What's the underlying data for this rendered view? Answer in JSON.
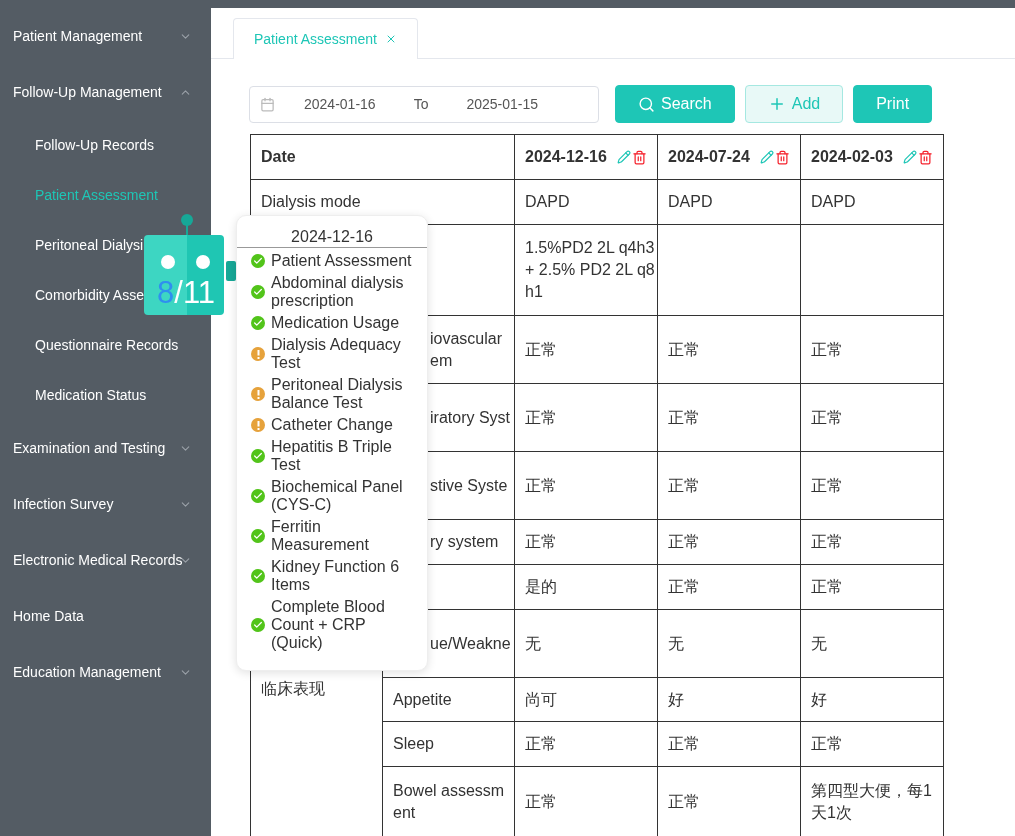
{
  "sidebar": {
    "items": [
      {
        "label": "Patient Management",
        "expandable": true,
        "expanded": false,
        "selected": false
      },
      {
        "label": "Follow-Up Management",
        "expandable": true,
        "expanded": true,
        "selected": false,
        "children": [
          {
            "label": "Follow-Up Records",
            "selected": false
          },
          {
            "label": "Patient Assessment",
            "selected": true
          },
          {
            "label": "Peritoneal Dialysi",
            "selected": false
          },
          {
            "label": "Comorbidity Asse",
            "selected": false
          },
          {
            "label": "Questionnaire Records",
            "selected": false
          },
          {
            "label": "Medication Status",
            "selected": false
          }
        ]
      },
      {
        "label": "Examination and Testing",
        "expandable": true,
        "expanded": false,
        "selected": false
      },
      {
        "label": "Infection Survey",
        "expandable": true,
        "expanded": false,
        "selected": false
      },
      {
        "label": "Electronic Medical Records",
        "expandable": true,
        "expanded": false,
        "selected": false
      },
      {
        "label": "Home Data",
        "expandable": false,
        "expanded": false,
        "selected": false
      },
      {
        "label": "Education Management",
        "expandable": true,
        "expanded": false,
        "selected": false
      }
    ]
  },
  "tabs": [
    {
      "label": "Patient Assessment",
      "selected": true
    }
  ],
  "filter": {
    "start": "2024-01-16",
    "separator": "To",
    "end": "2025-01-15"
  },
  "buttons": [
    {
      "label": "Search",
      "kind": "search"
    },
    {
      "label": "Add",
      "kind": "add"
    },
    {
      "label": "Print",
      "kind": "print"
    }
  ],
  "table": {
    "header": "Date",
    "columns": [
      {
        "date": "2024-12-16"
      },
      {
        "date": "2024-07-24"
      },
      {
        "date": "2024-02-03"
      }
    ],
    "group_label": "临床表现",
    "rows": [
      {
        "kind": "full",
        "label": "Dialysis mode",
        "values": [
          "DAPD",
          "DAPD",
          "DAPD"
        ]
      },
      {
        "kind": "full",
        "values": [
          "1.5%PD2 2L q4h3 + 2.5% PD2 2L q8h1"
        ]
      },
      {
        "kind": "partial",
        "label": "iovascular em",
        "values": [
          "正常",
          "正常",
          "正常"
        ]
      },
      {
        "kind": "partial",
        "label": "iratory Syst",
        "values": [
          "正常",
          "正常",
          "正常"
        ]
      },
      {
        "kind": "partial",
        "label": "stive Syste",
        "values": [
          "正常",
          "正常",
          "正常"
        ]
      },
      {
        "kind": "partial",
        "label": "ry system",
        "values": [
          "正常",
          "正常",
          "正常"
        ]
      },
      {
        "kind": "partial",
        "values": [
          "是的",
          "正常",
          "正常"
        ]
      },
      {
        "kind": "partial",
        "label": "ue/Weakne",
        "values": [
          "无",
          "无",
          "无"
        ]
      },
      {
        "kind": "sub",
        "label": "Appetite",
        "values": [
          "尚可",
          "好",
          "好"
        ]
      },
      {
        "kind": "sub",
        "label": "Sleep",
        "values": [
          "正常",
          "正常",
          "正常"
        ]
      },
      {
        "kind": "sub",
        "label": "Bowel assessment",
        "values": [
          "正常",
          "正常",
          "第四型大便，每1天1次"
        ]
      }
    ]
  },
  "robot": {
    "done": "8",
    "separator": "/",
    "total": "11"
  },
  "popover": {
    "title": "2024-12-16",
    "items": [
      {
        "label": "Patient Assessment",
        "kind": "done"
      },
      {
        "label": "Abdominal dialysis prescription",
        "kind": "done"
      },
      {
        "label": "Medication Usage",
        "kind": "done"
      },
      {
        "label": "Dialysis Adequacy Test",
        "kind": "pending"
      },
      {
        "label": "Peritoneal Dialysis Balance Test",
        "kind": "pending"
      },
      {
        "label": "Catheter Change",
        "kind": "pending"
      },
      {
        "label": "Hepatitis B Triple Test",
        "kind": "done"
      },
      {
        "label": "Biochemical Panel (CYS-C)",
        "kind": "done"
      },
      {
        "label": "Ferritin Measurement",
        "kind": "done"
      },
      {
        "label": "Kidney Function 6 Items",
        "kind": "done"
      },
      {
        "label": "Complete Blood Count + CRP (Quick)",
        "kind": "done"
      }
    ]
  }
}
